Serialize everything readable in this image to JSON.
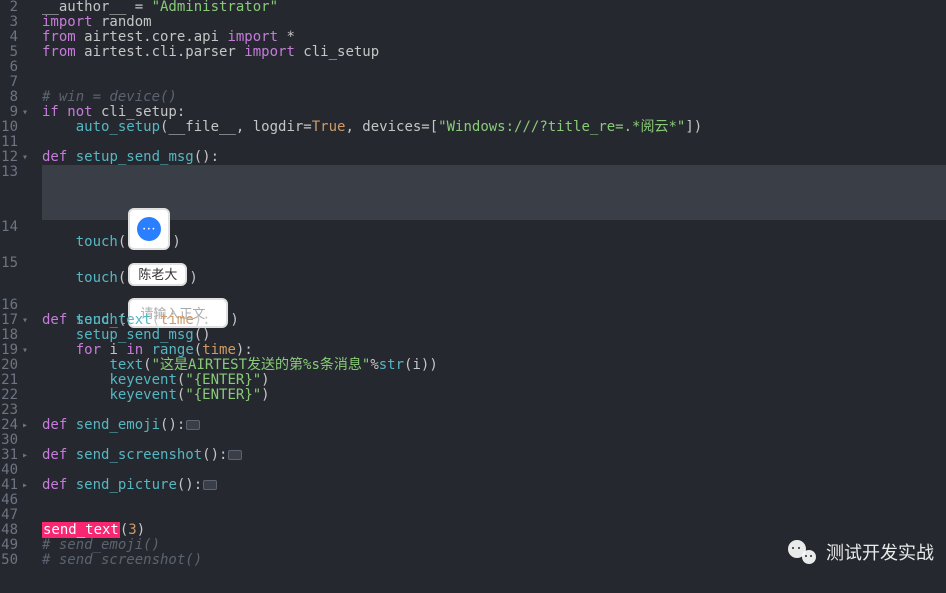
{
  "gutter": {
    "lines": [
      "2",
      "3",
      "4",
      "5",
      "6",
      "7",
      "8",
      "9",
      "10",
      "11",
      "12",
      "13",
      "14",
      "15",
      "16",
      "17",
      "18",
      "19",
      "20",
      "21",
      "22",
      "23",
      "24",
      "30",
      "31",
      "40",
      "41",
      "46",
      "47",
      "48",
      "49",
      "50"
    ],
    "folds": {
      "9": "▾",
      "12": "▾",
      "17": "▾",
      "19": "▾",
      "24": "▸",
      "31": "▸",
      "41": "▸"
    }
  },
  "code": {
    "l2_a": "__author__ ",
    "l2_b": "= ",
    "l2_c": "\"Administrator\"",
    "l3_a": "import",
    "l3_b": " random",
    "l4_a": "from",
    "l4_b": " airtest.core.api ",
    "l4_c": "import",
    "l4_d": " *",
    "l5_a": "from",
    "l5_b": " airtest.cli.parser ",
    "l5_c": "import",
    "l5_d": " cli_setup",
    "l8": "# win = device()",
    "l9_a": "if",
    "l9_b": " not",
    "l9_c": " cli_setup",
    "l10_a": "    ",
    "l10_b": "auto_setup",
    "l10_c": "(__file__, logdir=",
    "l10_d": "True",
    "l10_e": ", devices=[",
    "l10_f": "\"Windows:///?title_re=.*阅云*\"",
    "l10_g": "])",
    "l12_a": "def",
    "l12_b": " setup_send_msg",
    "l12_c": "():",
    "touch": "touch",
    "l17_a": "def",
    "l17_b": " send_text",
    "l17_c": "(",
    "l17_d": "time",
    "l17_e": "):",
    "l18_a": "    ",
    "l18_b": "setup_send_msg",
    "l18_c": "()",
    "l19_a": "    ",
    "l19_b": "for",
    "l19_c": " i ",
    "l19_d": "in",
    "l19_e": " ",
    "l19_f": "range",
    "l19_g": "(",
    "l19_h": "time",
    "l19_i": "):",
    "l20_a": "        ",
    "l20_b": "text",
    "l20_c": "(",
    "l20_d": "\"这是AIRTEST发送的第%s条消息\"",
    "l20_e": "%",
    "l20_f": "str",
    "l20_g": "(i))",
    "l21_a": "        ",
    "l21_b": "keyevent",
    "l21_c": "(",
    "l21_d": "\"{ENTER}\"",
    "l21_e": ")",
    "l22_a": "        ",
    "l22_b": "keyevent",
    "l22_c": "(",
    "l22_d": "\"{ENTER}\"",
    "l22_e": ")",
    "l24_a": "def",
    "l24_b": " send_emoji",
    "l24_c": "():",
    "l31_a": "def",
    "l31_b": " send_screenshot",
    "l31_c": "():",
    "l41_a": "def",
    "l41_b": " send_picture",
    "l41_c": "():",
    "l48_a": "send_text",
    "l48_b": "(",
    "l48_c": "3",
    "l48_d": ")",
    "l49": "# send_emoji()",
    "l50": "# send screenshot()"
  },
  "previews": {
    "name_text": "陈老大",
    "input_placeholder": "请输入正文"
  },
  "watermark": {
    "text": "测试开发实战"
  }
}
